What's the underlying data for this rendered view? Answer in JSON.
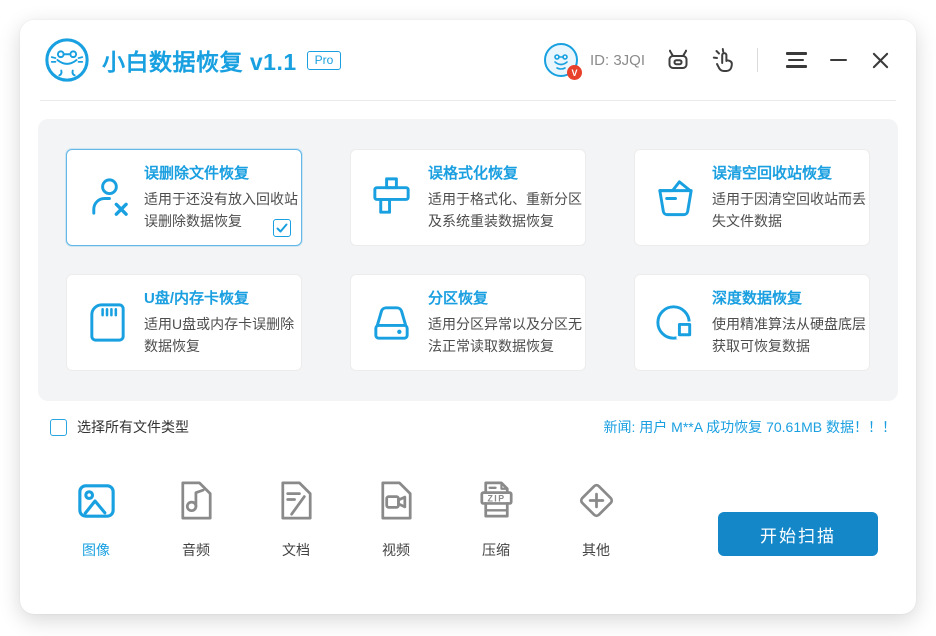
{
  "header": {
    "app_title": "小白数据恢复 v1.1",
    "pro_badge": "Pro",
    "user_id": "ID: 3JQI",
    "avatar_badge": "V"
  },
  "recovery_modes": {
    "items": [
      {
        "icon": "user-delete-icon",
        "title": "误删除文件恢复",
        "desc": "适用于还没有放入回收站误删除数据恢复",
        "selected": true,
        "checked": true
      },
      {
        "icon": "format-brush-icon",
        "title": "误格式化恢复",
        "desc": "适用于格式化、重新分区及系统重装数据恢复",
        "selected": false
      },
      {
        "icon": "recycle-bin-minus-icon",
        "title": "误清空回收站恢复",
        "desc": "适用于因清空回收站而丢失文件数据",
        "selected": false
      },
      {
        "icon": "sd-card-icon",
        "title": "U盘/内存卡恢复",
        "desc": "适用U盘或内存卡误删除数据恢复",
        "selected": false
      },
      {
        "icon": "hard-drive-icon",
        "title": "分区恢复",
        "desc": "适用分区异常以及分区无法正常读取数据恢复",
        "selected": false
      },
      {
        "icon": "deep-scan-icon",
        "title": "深度数据恢复",
        "desc": "使用精准算法从硬盘底层获取可恢复数据",
        "selected": false
      }
    ]
  },
  "select_all": {
    "label": "选择所有文件类型",
    "checked": false
  },
  "news_ticker": "新闻: 用户 M**A 成功恢复 70.61MB 数据！！！",
  "file_types": [
    {
      "icon": "image-file-icon",
      "label": "图像",
      "selected": true
    },
    {
      "icon": "audio-file-icon",
      "label": "音频",
      "selected": false
    },
    {
      "icon": "document-file-icon",
      "label": "文档",
      "selected": false
    },
    {
      "icon": "video-file-icon",
      "label": "视频",
      "selected": false
    },
    {
      "icon": "zip-file-icon",
      "label": "压缩",
      "selected": false
    },
    {
      "icon": "other-file-icon",
      "label": "其他",
      "selected": false
    }
  ],
  "icons": {
    "zip_text": "ZIP"
  },
  "scan_button_label": "开始扫描",
  "colors": {
    "brand_blue": "#18a0e0",
    "button_blue": "#1487c9",
    "panel_gray": "#f3f4f5",
    "badge_red": "#e8402a"
  }
}
